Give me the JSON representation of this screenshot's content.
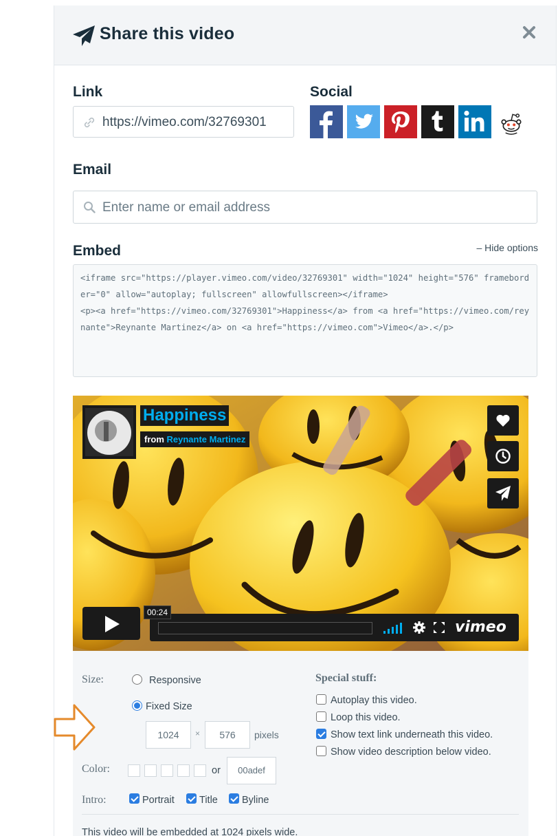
{
  "header": {
    "title": "Share this video",
    "icon": "paper-plane-icon",
    "close_icon": "close-icon"
  },
  "link": {
    "label": "Link",
    "url": "https://vimeo.com/32769301",
    "icon": "link-icon"
  },
  "social": {
    "label": "Social",
    "items": [
      {
        "name": "facebook",
        "color": "#3b5998"
      },
      {
        "name": "twitter",
        "color": "#55acee"
      },
      {
        "name": "pinterest",
        "color": "#cb2027"
      },
      {
        "name": "tumblr",
        "color": "#1a1a1a"
      },
      {
        "name": "linkedin",
        "color": "#0077b5"
      },
      {
        "name": "reddit",
        "color": "#ffffff"
      }
    ]
  },
  "email": {
    "label": "Email",
    "placeholder": "Enter name or email address",
    "icon": "search-icon"
  },
  "embed": {
    "label": "Embed",
    "hide_options": "– Hide options",
    "code": "<iframe src=\"https://player.vimeo.com/video/32769301\" width=\"1024\" height=\"576\" frameborder=\"0\" allow=\"autoplay; fullscreen\" allowfullscreen></iframe>\n<p><a href=\"https://vimeo.com/32769301\">Happiness</a> from <a href=\"https://vimeo.com/reynante\">Reynante Martinez</a> on <a href=\"https://vimeo.com\">Vimeo</a>.</p>"
  },
  "player": {
    "title": "Happiness",
    "from": "from",
    "author": "Reynante Martinez",
    "timecode": "00:24",
    "logo": "vimeo",
    "accent": "#00adef"
  },
  "options": {
    "size_label": "Size:",
    "responsive": "Responsive",
    "fixed": "Fixed Size",
    "fixed_selected": true,
    "width": "1024",
    "times": "×",
    "height": "576",
    "pixels": "pixels",
    "color_label": "Color:",
    "or": "or",
    "color_value": "00adef",
    "intro_label": "Intro:",
    "portrait": "Portrait",
    "title": "Title",
    "byline": "Byline",
    "special_label": "Special stuff:",
    "autoplay": "Autoplay this video.",
    "loop": "Loop this video.",
    "show_link": "Show text link underneath this video.",
    "show_desc": "Show video description below video.",
    "footer": "This video will be embedded at 1024 pixels wide."
  }
}
